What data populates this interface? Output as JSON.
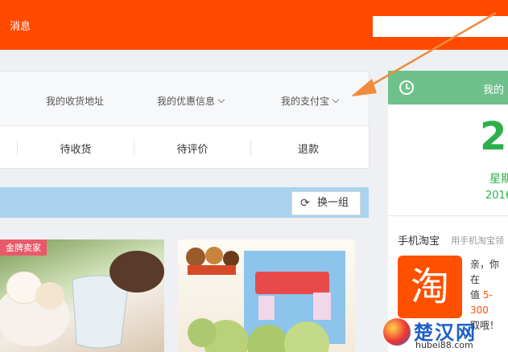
{
  "header": {
    "message_label": "消息",
    "search_placeholder": ""
  },
  "quick_links": [
    {
      "label": "我的收货地址",
      "has_dropdown": false
    },
    {
      "label": "我的优惠信息",
      "has_dropdown": true
    },
    {
      "label": "我的支付宝",
      "has_dropdown": true
    }
  ],
  "order_tabs": [
    "待收货",
    "待评价",
    "退款"
  ],
  "recommend": {
    "swap_label": "换一组",
    "swap_icon": "refresh-icon"
  },
  "products": [
    {
      "badge": "金牌卖家"
    },
    {
      "badge": ""
    }
  ],
  "calendar": {
    "title": "我的",
    "day": "2",
    "weekday": "星期",
    "year": "2016"
  },
  "mobile_taobao": {
    "title": "手机淘宝",
    "subtitle": "用手机淘宝领",
    "logo_char": "淘",
    "line1": "亲，你在",
    "line2_prefix": "值 ",
    "line2_value": "5-300",
    "line3": "取哦！"
  },
  "watermark": {
    "name": "楚汉网",
    "url": "hubei88.com"
  },
  "colors": {
    "brand": "#ff4a00",
    "calendar_green": "#6ec18a",
    "arrow": "#f08a3c",
    "badge": "#e85a6a"
  }
}
